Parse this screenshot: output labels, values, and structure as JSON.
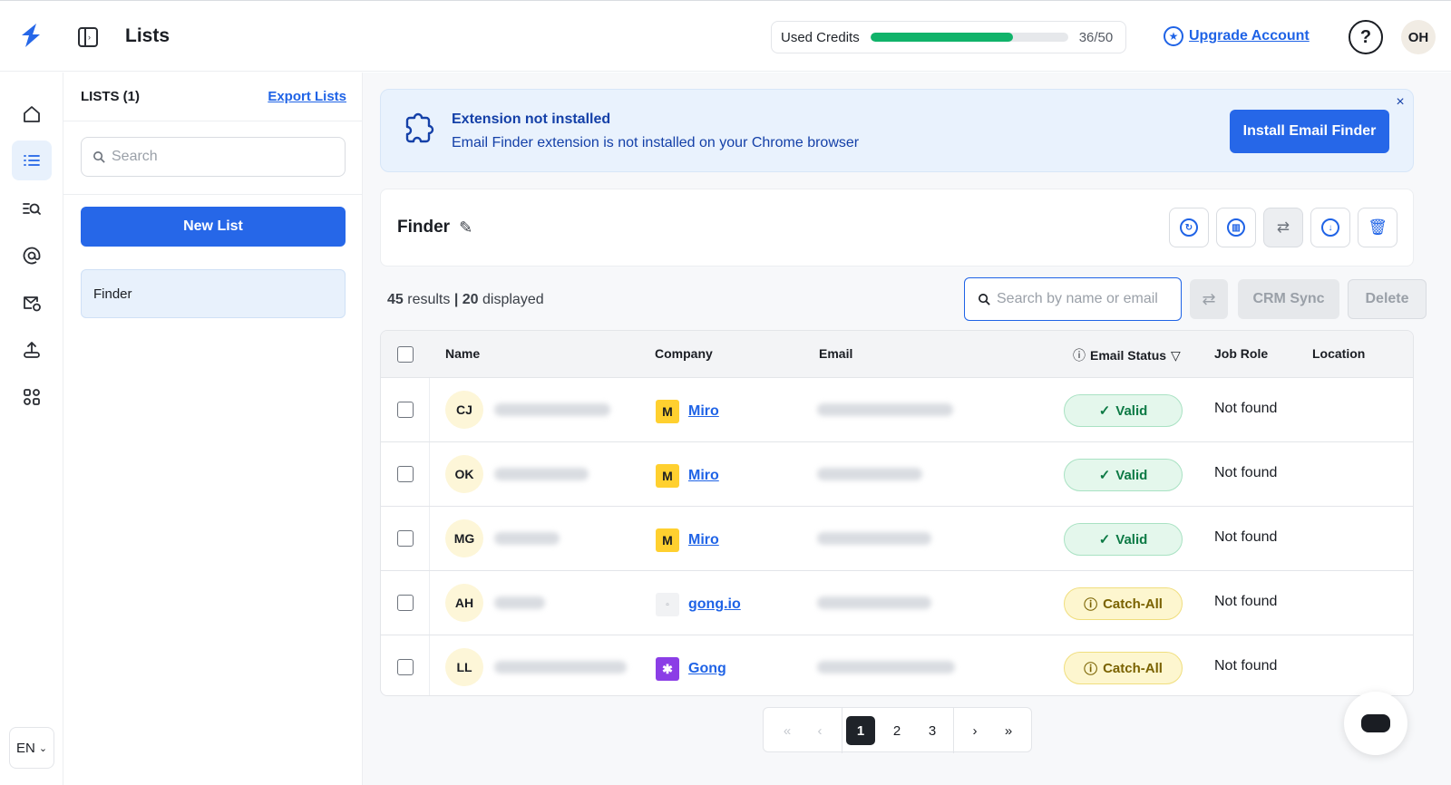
{
  "header": {
    "title": "Lists",
    "credits_label": "Used Credits",
    "credits_used": 36,
    "credits_total": 50,
    "credits_text": "36/50",
    "credits_color": "#10b36a",
    "upgrade_label": "Upgrade Account",
    "help_glyph": "?",
    "avatar_initials": "OH"
  },
  "rail": {
    "items": [
      "home-icon",
      "list-icon",
      "search-list-icon",
      "at-icon",
      "mail-check-icon",
      "upload-icon",
      "workflow-icon"
    ],
    "language": "EN"
  },
  "lists_panel": {
    "title": "LISTS (1)",
    "export_label": "Export Lists",
    "search_placeholder": "Search",
    "new_list_label": "New List",
    "items": [
      {
        "label": "Finder"
      }
    ]
  },
  "banner": {
    "title": "Extension not installed",
    "text": "Email Finder extension is not installed on your Chrome browser",
    "button_label": "Install Email Finder",
    "close_glyph": "×"
  },
  "finder": {
    "title": "Finder",
    "toolbar_icons": [
      "refresh-icon",
      "enrich-icon",
      "swap-icon",
      "download-icon",
      "trash-icon"
    ]
  },
  "results": {
    "count": "45",
    "count_suffix": "results",
    "separator": "|",
    "displayed": "20",
    "displayed_suffix": "displayed"
  },
  "table_actions": {
    "search_placeholder": "Search by name or email",
    "crm_label": "CRM Sync",
    "delete_label": "Delete"
  },
  "table": {
    "headers": {
      "name": "Name",
      "company": "Company",
      "email": "Email",
      "email_status": "Email Status",
      "job_role": "Job Role",
      "location": "Location"
    },
    "rows": [
      {
        "initials": "CJ",
        "company": "Miro",
        "company_logo": "miro",
        "logo_glyph": "M",
        "status": "Valid",
        "status_type": "valid",
        "status_glyph": "✓",
        "job_role": "Not found"
      },
      {
        "initials": "OK",
        "company": "Miro",
        "company_logo": "miro",
        "logo_glyph": "M",
        "status": "Valid",
        "status_type": "valid",
        "status_glyph": "✓",
        "job_role": "Not found"
      },
      {
        "initials": "MG",
        "company": "Miro",
        "company_logo": "miro",
        "logo_glyph": "M",
        "status": "Valid",
        "status_type": "valid",
        "status_glyph": "✓",
        "job_role": "Not found"
      },
      {
        "initials": "AH",
        "company": "gong.io",
        "company_logo": "gong-io",
        "logo_glyph": "▫",
        "status": "Catch-All",
        "status_type": "catch",
        "status_glyph": "ⓘ",
        "job_role": "Not found"
      },
      {
        "initials": "LL",
        "company": "Gong",
        "company_logo": "gong",
        "logo_glyph": "✱",
        "status": "Catch-All",
        "status_type": "catch",
        "status_glyph": "ⓘ",
        "job_role": "Not found"
      }
    ]
  },
  "pagination": {
    "first": "«",
    "prev": "‹",
    "pages": [
      "1",
      "2",
      "3"
    ],
    "current": "1",
    "next": "›",
    "last": "»"
  }
}
